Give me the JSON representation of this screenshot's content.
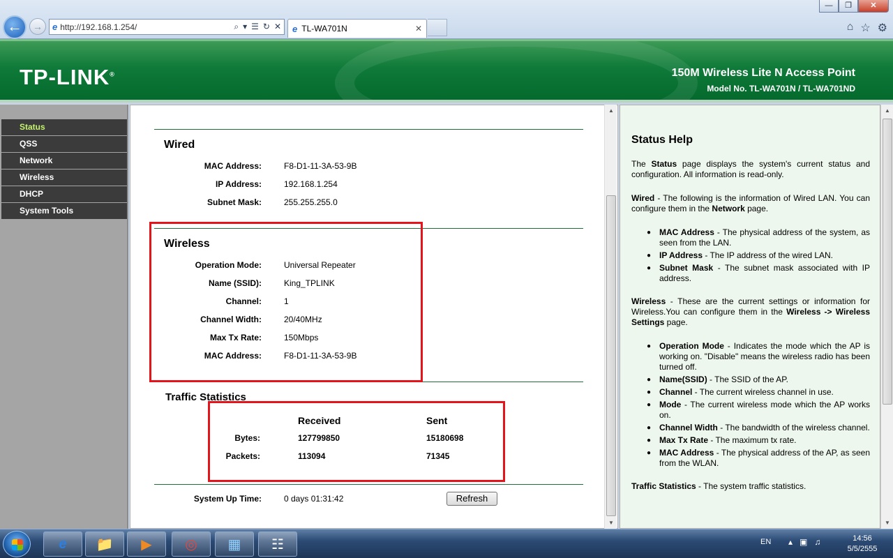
{
  "browser": {
    "url": "http://192.168.1.254/",
    "tab_title": "TL-WA701N",
    "window_buttons": {
      "minimize": "—",
      "maximize": "❐",
      "close": "✕"
    }
  },
  "header": {
    "logo": "TP-LINK",
    "product_title": "150M Wireless Lite N Access Point",
    "model": "Model No. TL-WA701N / TL-WA701ND"
  },
  "menu": {
    "items": [
      {
        "label": "Status",
        "active": true
      },
      {
        "label": "QSS"
      },
      {
        "label": "Network"
      },
      {
        "label": "Wireless"
      },
      {
        "label": "DHCP"
      },
      {
        "label": "System Tools"
      }
    ]
  },
  "wired": {
    "title": "Wired",
    "rows": [
      {
        "label": "MAC Address:",
        "value": "F8-D1-11-3A-53-9B"
      },
      {
        "label": "IP Address:",
        "value": "192.168.1.254"
      },
      {
        "label": "Subnet Mask:",
        "value": "255.255.255.0"
      }
    ]
  },
  "wireless": {
    "title": "Wireless",
    "rows": [
      {
        "label": "Operation Mode:",
        "value": "Universal Repeater"
      },
      {
        "label": "Name (SSID):",
        "value": "King_TPLINK"
      },
      {
        "label": "Channel:",
        "value": "1"
      },
      {
        "label": "Channel Width:",
        "value": "20/40MHz"
      },
      {
        "label": "Max Tx Rate:",
        "value": "150Mbps"
      },
      {
        "label": "MAC Address:",
        "value": "F8-D1-11-3A-53-9B"
      }
    ]
  },
  "traffic": {
    "title": "Traffic Statistics",
    "col_received": "Received",
    "col_sent": "Sent",
    "bytes_label": "Bytes:",
    "bytes_received": "127799850",
    "bytes_sent": "15180698",
    "packets_label": "Packets:",
    "packets_received": "113094",
    "packets_sent": "71345"
  },
  "uptime": {
    "label": "System Up Time:",
    "value": "0 days 01:31:42",
    "refresh_label": "Refresh"
  },
  "help": {
    "title": "Status Help",
    "intro_pre": "The ",
    "intro_bold": "Status",
    "intro_post": " page displays the system's current status and configuration. All information is read-only.",
    "wired_bold": "Wired",
    "wired_text": " - The following is the information of Wired LAN. You can configure them in the ",
    "wired_link": "Network",
    "wired_end": " page.",
    "wired_items": [
      {
        "bold": "MAC Address",
        "text": " - The physical address of the system, as seen from the LAN."
      },
      {
        "bold": "IP Address",
        "text": " - The IP address of the wired LAN."
      },
      {
        "bold": "Subnet Mask",
        "text": " - The subnet mask associated with IP address."
      }
    ],
    "wireless_bold": "Wireless",
    "wireless_text": " - These are the current settings or information for Wireless.You can configure them in the ",
    "wireless_link": "Wireless -> Wireless Settings",
    "wireless_end": " page.",
    "wireless_items": [
      {
        "bold": "Operation Mode",
        "text": " - Indicates the mode which the AP is working on. \"Disable\" means the wireless radio has been turned off."
      },
      {
        "bold": "Name(SSID)",
        "text": " - The SSID of the AP."
      },
      {
        "bold": "Channel",
        "text": " - The current wireless channel in use."
      },
      {
        "bold": "Mode",
        "text": " - The current wireless mode which the AP works on."
      },
      {
        "bold": "Channel Width",
        "text": " - The bandwidth of the wireless channel."
      },
      {
        "bold": "Max Tx Rate",
        "text": " - The maximum tx rate."
      },
      {
        "bold": "MAC Address",
        "text": " - The physical address of the AP, as seen from the WLAN."
      }
    ],
    "traffic_bold": "Traffic Statistics",
    "traffic_text": " - The system traffic statistics."
  },
  "taskbar": {
    "lang": "EN",
    "time": "14:56",
    "date": "5/5/2555"
  }
}
